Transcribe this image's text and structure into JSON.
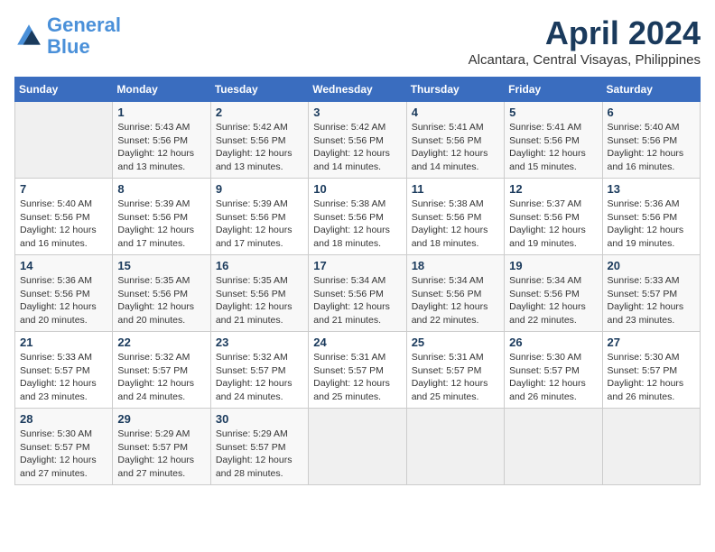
{
  "header": {
    "logo_line1": "General",
    "logo_line2": "Blue",
    "month_title": "April 2024",
    "location": "Alcantara, Central Visayas, Philippines"
  },
  "calendar": {
    "weekdays": [
      "Sunday",
      "Monday",
      "Tuesday",
      "Wednesday",
      "Thursday",
      "Friday",
      "Saturday"
    ],
    "weeks": [
      [
        {
          "day": "",
          "info": ""
        },
        {
          "day": "1",
          "info": "Sunrise: 5:43 AM\nSunset: 5:56 PM\nDaylight: 12 hours\nand 13 minutes."
        },
        {
          "day": "2",
          "info": "Sunrise: 5:42 AM\nSunset: 5:56 PM\nDaylight: 12 hours\nand 13 minutes."
        },
        {
          "day": "3",
          "info": "Sunrise: 5:42 AM\nSunset: 5:56 PM\nDaylight: 12 hours\nand 14 minutes."
        },
        {
          "day": "4",
          "info": "Sunrise: 5:41 AM\nSunset: 5:56 PM\nDaylight: 12 hours\nand 14 minutes."
        },
        {
          "day": "5",
          "info": "Sunrise: 5:41 AM\nSunset: 5:56 PM\nDaylight: 12 hours\nand 15 minutes."
        },
        {
          "day": "6",
          "info": "Sunrise: 5:40 AM\nSunset: 5:56 PM\nDaylight: 12 hours\nand 16 minutes."
        }
      ],
      [
        {
          "day": "7",
          "info": "Sunrise: 5:40 AM\nSunset: 5:56 PM\nDaylight: 12 hours\nand 16 minutes."
        },
        {
          "day": "8",
          "info": "Sunrise: 5:39 AM\nSunset: 5:56 PM\nDaylight: 12 hours\nand 17 minutes."
        },
        {
          "day": "9",
          "info": "Sunrise: 5:39 AM\nSunset: 5:56 PM\nDaylight: 12 hours\nand 17 minutes."
        },
        {
          "day": "10",
          "info": "Sunrise: 5:38 AM\nSunset: 5:56 PM\nDaylight: 12 hours\nand 18 minutes."
        },
        {
          "day": "11",
          "info": "Sunrise: 5:38 AM\nSunset: 5:56 PM\nDaylight: 12 hours\nand 18 minutes."
        },
        {
          "day": "12",
          "info": "Sunrise: 5:37 AM\nSunset: 5:56 PM\nDaylight: 12 hours\nand 19 minutes."
        },
        {
          "day": "13",
          "info": "Sunrise: 5:36 AM\nSunset: 5:56 PM\nDaylight: 12 hours\nand 19 minutes."
        }
      ],
      [
        {
          "day": "14",
          "info": "Sunrise: 5:36 AM\nSunset: 5:56 PM\nDaylight: 12 hours\nand 20 minutes."
        },
        {
          "day": "15",
          "info": "Sunrise: 5:35 AM\nSunset: 5:56 PM\nDaylight: 12 hours\nand 20 minutes."
        },
        {
          "day": "16",
          "info": "Sunrise: 5:35 AM\nSunset: 5:56 PM\nDaylight: 12 hours\nand 21 minutes."
        },
        {
          "day": "17",
          "info": "Sunrise: 5:34 AM\nSunset: 5:56 PM\nDaylight: 12 hours\nand 21 minutes."
        },
        {
          "day": "18",
          "info": "Sunrise: 5:34 AM\nSunset: 5:56 PM\nDaylight: 12 hours\nand 22 minutes."
        },
        {
          "day": "19",
          "info": "Sunrise: 5:34 AM\nSunset: 5:56 PM\nDaylight: 12 hours\nand 22 minutes."
        },
        {
          "day": "20",
          "info": "Sunrise: 5:33 AM\nSunset: 5:57 PM\nDaylight: 12 hours\nand 23 minutes."
        }
      ],
      [
        {
          "day": "21",
          "info": "Sunrise: 5:33 AM\nSunset: 5:57 PM\nDaylight: 12 hours\nand 23 minutes."
        },
        {
          "day": "22",
          "info": "Sunrise: 5:32 AM\nSunset: 5:57 PM\nDaylight: 12 hours\nand 24 minutes."
        },
        {
          "day": "23",
          "info": "Sunrise: 5:32 AM\nSunset: 5:57 PM\nDaylight: 12 hours\nand 24 minutes."
        },
        {
          "day": "24",
          "info": "Sunrise: 5:31 AM\nSunset: 5:57 PM\nDaylight: 12 hours\nand 25 minutes."
        },
        {
          "day": "25",
          "info": "Sunrise: 5:31 AM\nSunset: 5:57 PM\nDaylight: 12 hours\nand 25 minutes."
        },
        {
          "day": "26",
          "info": "Sunrise: 5:30 AM\nSunset: 5:57 PM\nDaylight: 12 hours\nand 26 minutes."
        },
        {
          "day": "27",
          "info": "Sunrise: 5:30 AM\nSunset: 5:57 PM\nDaylight: 12 hours\nand 26 minutes."
        }
      ],
      [
        {
          "day": "28",
          "info": "Sunrise: 5:30 AM\nSunset: 5:57 PM\nDaylight: 12 hours\nand 27 minutes."
        },
        {
          "day": "29",
          "info": "Sunrise: 5:29 AM\nSunset: 5:57 PM\nDaylight: 12 hours\nand 27 minutes."
        },
        {
          "day": "30",
          "info": "Sunrise: 5:29 AM\nSunset: 5:57 PM\nDaylight: 12 hours\nand 28 minutes."
        },
        {
          "day": "",
          "info": ""
        },
        {
          "day": "",
          "info": ""
        },
        {
          "day": "",
          "info": ""
        },
        {
          "day": "",
          "info": ""
        }
      ]
    ]
  }
}
